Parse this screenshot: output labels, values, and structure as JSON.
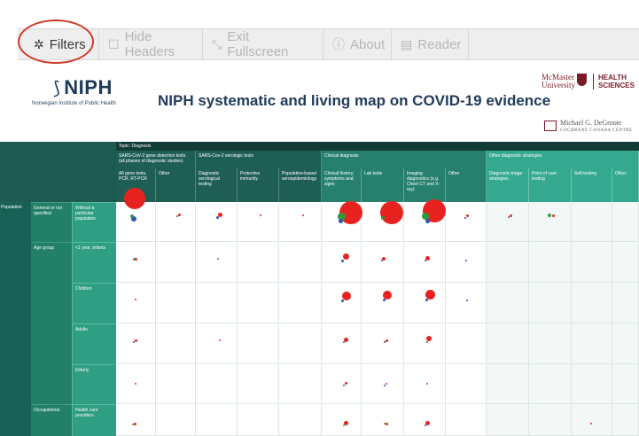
{
  "toolbar": {
    "filters": {
      "label": "Filters",
      "icon": "gear-icon"
    },
    "hide_headers": {
      "label": "Hide Headers",
      "icon": "square-icon"
    },
    "exit_fullscreen": {
      "label": "Exit Fullscreen",
      "icon": "compress-icon"
    },
    "about": {
      "label": "About",
      "icon": "info-icon"
    },
    "reader": {
      "label": "Reader",
      "icon": "reader-icon"
    }
  },
  "header": {
    "niph_logo": "NIPH",
    "niph_sub": "Norwegian Institute of Public Health",
    "title": "NIPH systematic and living map on COVID-19 evidence",
    "mcmaster_line1": "McMaster",
    "mcmaster_line2": "University",
    "health_sciences_line1": "HEALTH",
    "health_sciences_line2": "SCIENCES",
    "degroote_line1": "Michael G. DeGroote",
    "degroote_line2": "COCHRANE CANADA CENTRE"
  },
  "colors": {
    "toolbar_bg": "#eeeeee",
    "highlight_circle": "#d23a2b",
    "dark_green": "#176157",
    "mid_green": "#27806e",
    "light_green": "#35a98f",
    "dot_red": "#e8231f",
    "dot_green": "#2e9a3e",
    "dot_blue": "#2f55b5"
  },
  "grid": {
    "topic": "Topic: Diagnosis",
    "groups": [
      "SARS-CoV-2 gene detection tests (all phases of diagnostic studies)",
      "SARS-Cov-2 serologic tests",
      "Clinical diagnosis",
      "Other diagnostic strategies"
    ],
    "subgroups": [
      "All gene tests, PCR, RT-PCR",
      "Other",
      "Diagnostic serological testing",
      "Protective immunity",
      "Population-based seroepidemiology",
      "Clinical history, symptoms and signs",
      "Lab tests",
      "Imaging diagnostics (e.g. Chest CT and X-ray)",
      "Other",
      "Diagnostic triage strategies",
      "Point of care testing",
      "Self-testing",
      "Other"
    ],
    "dimension": "Population",
    "row_groups": [
      "General or not specified",
      "Age group",
      "Occupational"
    ],
    "rows": [
      "Without a particular population",
      "<1 year, infants",
      "Children",
      "Adults",
      "Elderly",
      "Health care providers"
    ]
  }
}
